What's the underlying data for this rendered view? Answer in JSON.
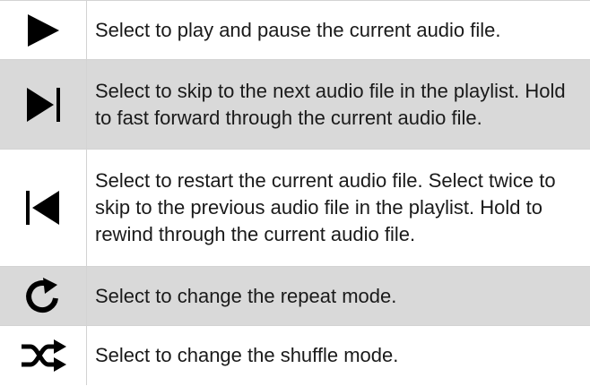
{
  "controls": [
    {
      "icon": "play-pause-icon",
      "shaded": false,
      "text": "Select to play and pause the current audio file."
    },
    {
      "icon": "skip-next-icon",
      "shaded": true,
      "text": "Select to skip to the next audio file in the playlist. Hold to fast forward through the current audio file."
    },
    {
      "icon": "skip-previous-icon",
      "shaded": false,
      "text": "Select to restart the current audio file. Select twice to skip to the previous audio file in the playlist. Hold to rewind through the current audio file."
    },
    {
      "icon": "repeat-icon",
      "shaded": true,
      "text": "Select to change the repeat mode."
    },
    {
      "icon": "shuffle-icon",
      "shaded": false,
      "text": "Select to change the shuffle mode."
    }
  ]
}
